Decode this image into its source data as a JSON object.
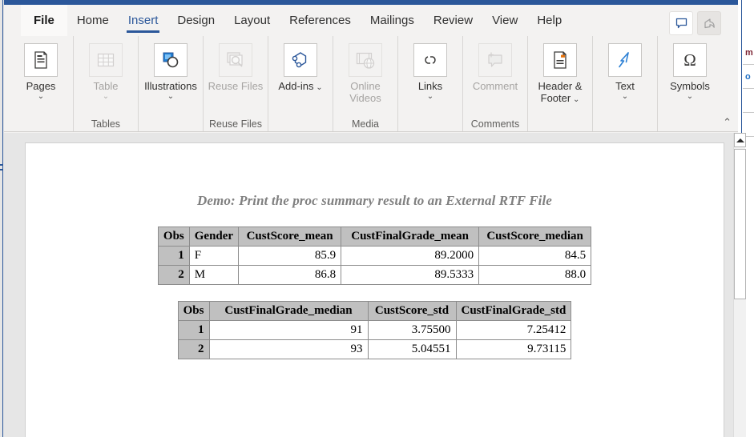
{
  "app": {
    "name": "Microsoft Word",
    "accent_color": "#2b579a",
    "ribbon_bg": "#f3f2f1",
    "canvas_color": "#e6e6e6"
  },
  "tabs": [
    {
      "label": "File",
      "icon": "file-tab",
      "active": false,
      "style": "file"
    },
    {
      "label": "Home",
      "icon": "home-tab",
      "active": false,
      "style": ""
    },
    {
      "label": "Insert",
      "icon": "insert-tab",
      "active": true,
      "style": ""
    },
    {
      "label": "Design",
      "icon": "design-tab",
      "active": false,
      "style": ""
    },
    {
      "label": "Layout",
      "icon": "layout-tab",
      "active": false,
      "style": ""
    },
    {
      "label": "References",
      "icon": "ref-tab",
      "active": false,
      "style": ""
    },
    {
      "label": "Mailings",
      "icon": "mail-tab",
      "active": false,
      "style": ""
    },
    {
      "label": "Review",
      "icon": "review-tab",
      "active": false,
      "style": ""
    },
    {
      "label": "View",
      "icon": "view-tab",
      "active": false,
      "style": ""
    },
    {
      "label": "Help",
      "icon": "help-tab",
      "active": false,
      "style": ""
    }
  ],
  "topright": {
    "comment_icon": "comment-icon",
    "share_icon": "share-icon",
    "share_disabled": true
  },
  "ribbon": {
    "collapse_glyph": "⌃",
    "groups": [
      {
        "label": "",
        "items": [
          {
            "label": "Pages",
            "icon": "pages-icon",
            "dropdown": true,
            "disabled": false,
            "chev_below": true
          }
        ]
      },
      {
        "label": "Tables",
        "items": [
          {
            "label": "Table",
            "icon": "table-icon",
            "dropdown": true,
            "disabled": true,
            "chev_below": true
          }
        ]
      },
      {
        "label": "",
        "items": [
          {
            "label": "Illustrations",
            "icon": "illustrations-icon",
            "dropdown": true,
            "disabled": false,
            "chev_below": true
          }
        ]
      },
      {
        "label": "Reuse Files",
        "items": [
          {
            "label": "Reuse Files",
            "icon": "reuse-files-icon",
            "dropdown": false,
            "disabled": true,
            "chev_below": false
          }
        ]
      },
      {
        "label": "",
        "items": [
          {
            "label": "Add-ins",
            "icon": "addins-icon",
            "dropdown": true,
            "disabled": false,
            "chev_below": false
          }
        ]
      },
      {
        "label": "Media",
        "items": [
          {
            "label": "Online Videos",
            "icon": "online-videos-icon",
            "dropdown": false,
            "disabled": true,
            "chev_below": false
          }
        ]
      },
      {
        "label": "",
        "items": [
          {
            "label": "Links",
            "icon": "links-icon",
            "dropdown": true,
            "disabled": false,
            "chev_below": true
          }
        ]
      },
      {
        "label": "Comments",
        "items": [
          {
            "label": "Comment",
            "icon": "comment-ribbon-icon",
            "dropdown": false,
            "disabled": true,
            "chev_below": false
          }
        ]
      },
      {
        "label": "",
        "items": [
          {
            "label": "Header & Footer",
            "icon": "header-footer-icon",
            "dropdown": true,
            "disabled": false,
            "chev_below": false
          }
        ]
      },
      {
        "label": "",
        "items": [
          {
            "label": "Text",
            "icon": "text-icon",
            "dropdown": true,
            "disabled": false,
            "chev_below": true
          }
        ]
      },
      {
        "label": "",
        "items": [
          {
            "label": "Symbols",
            "icon": "symbols-icon",
            "glyph": "Ω",
            "dropdown": true,
            "disabled": false,
            "chev_below": true
          }
        ]
      }
    ]
  },
  "document": {
    "title": "Demo: Print the proc summary result to an External RTF File",
    "title_color": "#808080",
    "table1": {
      "headers": [
        "Obs",
        "Gender",
        "CustScore_mean",
        "CustFinalGrade_mean",
        "CustScore_median"
      ],
      "rows": [
        {
          "obs": "1",
          "gender": "F",
          "custscore_mean": "85.9",
          "custfinalgrade_mean": "89.2000",
          "custscore_median": "84.5"
        },
        {
          "obs": "2",
          "gender": "M",
          "custscore_mean": "86.8",
          "custfinalgrade_mean": "89.5333",
          "custscore_median": "88.0"
        }
      ]
    },
    "table2": {
      "headers": [
        "Obs",
        "CustFinalGrade_median",
        "CustScore_std",
        "CustFinalGrade_std"
      ],
      "rows": [
        {
          "obs": "1",
          "custfinalgrade_median": "91",
          "custscore_std": "3.75500",
          "custfinalgrade_std": "7.25412"
        },
        {
          "obs": "2",
          "custfinalgrade_median": "93",
          "custscore_std": "5.04551",
          "custfinalgrade_std": "9.73115"
        }
      ]
    }
  },
  "scrollbar": {
    "up_arrow": "scroll-up-arrow",
    "orientation": "vertical"
  },
  "background_window": {
    "fragment_1": "m",
    "fragment_2": "o"
  }
}
